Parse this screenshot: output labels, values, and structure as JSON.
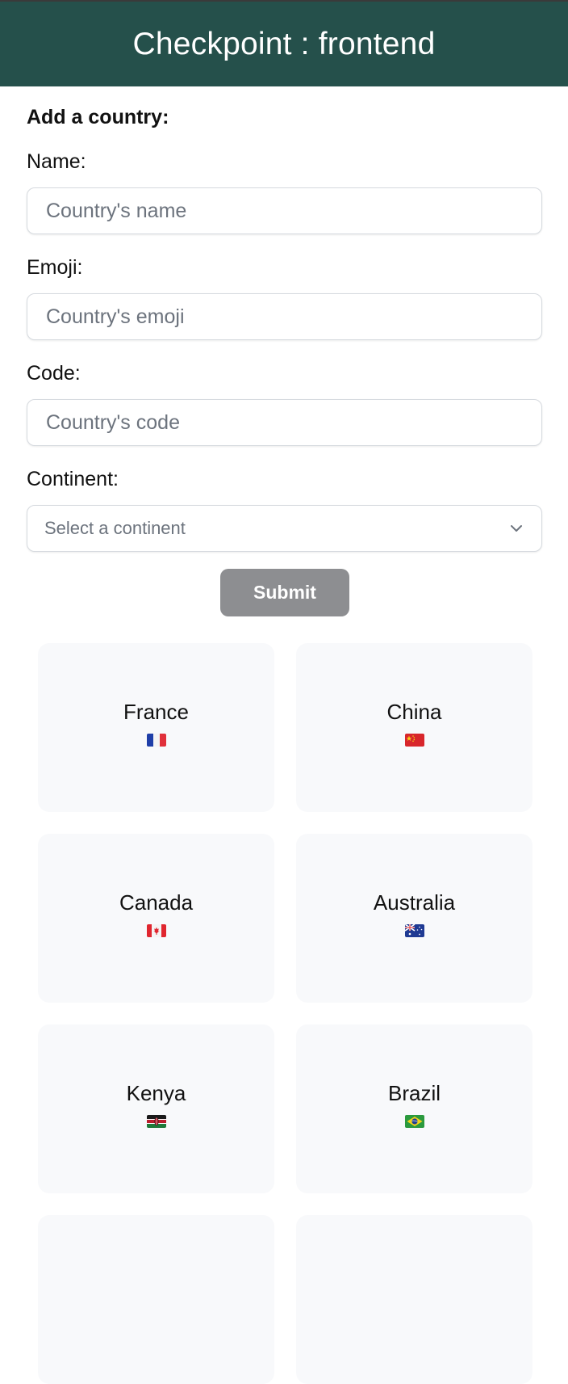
{
  "header": {
    "title": "Checkpoint : frontend"
  },
  "form": {
    "heading": "Add a country:",
    "name": {
      "label": "Name:",
      "placeholder": "Country's name",
      "value": ""
    },
    "emoji": {
      "label": "Emoji:",
      "placeholder": "Country's emoji",
      "value": ""
    },
    "code": {
      "label": "Code:",
      "placeholder": "Country's code",
      "value": ""
    },
    "continent": {
      "label": "Continent:",
      "selected": "Select a continent",
      "icon": "chevron-down-icon"
    },
    "submit_label": "Submit",
    "submit_color": "#8d8e91"
  },
  "theme": {
    "header_bg": "#25504b",
    "card_bg": "#f8f9fb"
  },
  "countries": [
    {
      "name": "France",
      "flag_icon": "france-flag-icon"
    },
    {
      "name": "China",
      "flag_icon": "china-flag-icon"
    },
    {
      "name": "Canada",
      "flag_icon": "canada-flag-icon"
    },
    {
      "name": "Australia",
      "flag_icon": "australia-flag-icon"
    },
    {
      "name": "Kenya",
      "flag_icon": "kenya-flag-icon"
    },
    {
      "name": "Brazil",
      "flag_icon": "brazil-flag-icon"
    }
  ]
}
